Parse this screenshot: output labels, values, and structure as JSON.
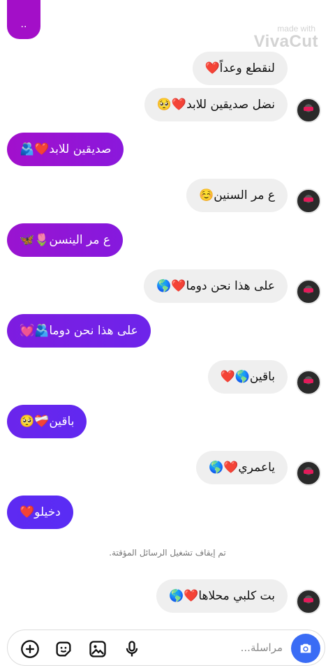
{
  "header": {
    "top_bubble_text": ".."
  },
  "watermark": {
    "line1": "made with",
    "line2": "VivaCut"
  },
  "messages": [
    {
      "text": "لنقطع وعداً❤️",
      "sender": "them"
    },
    {
      "text": "نضل صديقين للابد❤️🥺",
      "sender": "them"
    },
    {
      "text": "صديقين للابد❤️🫂",
      "sender": "me"
    },
    {
      "text": "ع مر السنين☺️",
      "sender": "them"
    },
    {
      "text": "ع مر الينسن🌷🦋",
      "sender": "me"
    },
    {
      "text": "على هذا نحن دوما❤️🌎",
      "sender": "them"
    },
    {
      "text": "على هذا نحن دوما🫂💓",
      "sender": "me"
    },
    {
      "text": "باقين🌎❤️",
      "sender": "them"
    },
    {
      "text": "باقين❤️‍🩹🥺",
      "sender": "me"
    },
    {
      "text": "ياعمري❤️🌎",
      "sender": "them"
    },
    {
      "text": "دخيلو❤️",
      "sender": "me"
    },
    {
      "text": "بت كلبي محلاها❤️🌎",
      "sender": "them"
    }
  ],
  "system": {
    "vanish_off": "تم إيقاف تشغيل الرسائل المؤقتة."
  },
  "composer": {
    "placeholder": "مراسلة...",
    "icons": [
      "camera-icon",
      "microphone-icon",
      "image-icon",
      "sticker-icon",
      "plus-icon"
    ]
  },
  "colors": {
    "accent_blue": "#3a6cf5",
    "gradient_purple": "#a30fc8",
    "gradient_violet": "#5b2cf5",
    "incoming_bubble": "#efefef"
  }
}
